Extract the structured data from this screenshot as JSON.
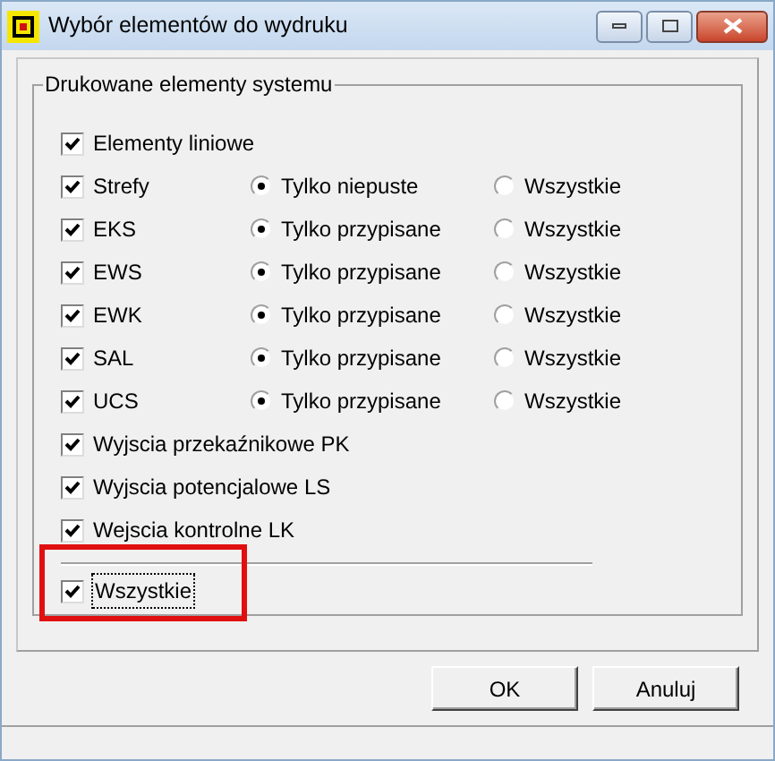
{
  "window": {
    "title": "Wybór elementów do wydruku"
  },
  "group": {
    "title": "Drukowane elementy systemu",
    "items": [
      {
        "label": "Elementy liniowe",
        "checked": true
      },
      {
        "label": "Strefy",
        "checked": true,
        "options": [
          {
            "label": "Tylko niepuste",
            "selected": true
          },
          {
            "label": "Wszystkie",
            "selected": false
          }
        ]
      },
      {
        "label": "EKS",
        "checked": true,
        "options": [
          {
            "label": "Tylko przypisane",
            "selected": true
          },
          {
            "label": "Wszystkie",
            "selected": false
          }
        ]
      },
      {
        "label": "EWS",
        "checked": true,
        "options": [
          {
            "label": "Tylko przypisane",
            "selected": true
          },
          {
            "label": "Wszystkie",
            "selected": false
          }
        ]
      },
      {
        "label": "EWK",
        "checked": true,
        "options": [
          {
            "label": "Tylko przypisane",
            "selected": true
          },
          {
            "label": "Wszystkie",
            "selected": false
          }
        ]
      },
      {
        "label": "SAL",
        "checked": true,
        "options": [
          {
            "label": "Tylko przypisane",
            "selected": true
          },
          {
            "label": "Wszystkie",
            "selected": false
          }
        ]
      },
      {
        "label": "UCS",
        "checked": true,
        "options": [
          {
            "label": "Tylko przypisane",
            "selected": true
          },
          {
            "label": "Wszystkie",
            "selected": false
          }
        ]
      },
      {
        "label": "Wyjscia przekaźnikowe PK",
        "checked": true
      },
      {
        "label": "Wyjscia potencjalowe LS",
        "checked": true
      },
      {
        "label": "Wejscia kontrolne LK",
        "checked": true
      }
    ],
    "all": {
      "label": "Wszystkie",
      "checked": true,
      "focused": true,
      "highlighted": true
    }
  },
  "buttons": [
    {
      "label": "OK"
    },
    {
      "label": "Anuluj"
    }
  ]
}
